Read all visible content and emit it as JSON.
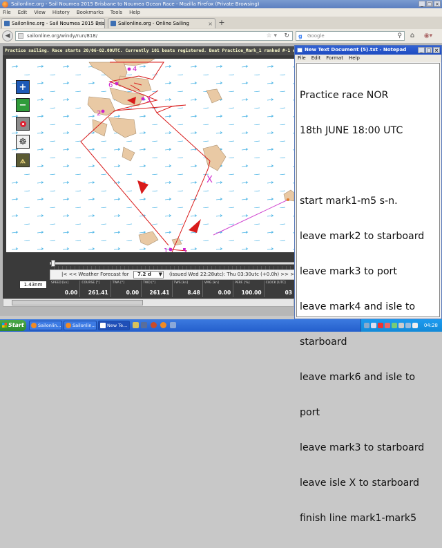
{
  "browser": {
    "window_title": "Sailonline.org - Sail Noumea 2015 Brisbane to Noumea Ocean Race - Mozilla Firefox (Private Browsing)",
    "menu": [
      "File",
      "Edit",
      "View",
      "History",
      "Bookmarks",
      "Tools",
      "Help"
    ],
    "tabs": [
      {
        "label": "Sailonline.org - Sail Noumea 2015 Brisban..."
      },
      {
        "label": "Sailonline.org - Online Sailing"
      }
    ],
    "new_tab": "+",
    "url": "sailonline.org/windy/run/818/",
    "search_placeholder": "Google"
  },
  "race": {
    "status_text": "Practice sailing. Race starts 20/06-02.00UTC. Currently 101 boats registered. Boat Practice_Mark_1 ranked #-1 with",
    "map_labels": {
      "mark4": "4",
      "mark6": "6",
      "mark3": "3",
      "mark2": "2",
      "mark1": "1",
      "mark5": "5",
      "isle_x": "X"
    },
    "scale_label": "1.43nm",
    "forecast": {
      "nav_prev": "|< << Weather Forecast for",
      "selected": "7.2 d",
      "issued": "(issued Wed 22:28utc): Thu 03:30utc (+0.0h) >> >|"
    },
    "stats": [
      {
        "label": "SPEED [kn]",
        "value": "0.00"
      },
      {
        "label": "COURSE [°]",
        "value": "261.41"
      },
      {
        "label": "TWA [°]",
        "value": "0.00"
      },
      {
        "label": "TWD [°]",
        "value": "261.41"
      },
      {
        "label": "TWS [kn]",
        "value": "8.48"
      },
      {
        "label": "VMG [kn]",
        "value": "0.00"
      },
      {
        "label": "PERF. [%]",
        "value": "100.00"
      },
      {
        "label": "CLOCK [UTC]",
        "value": "03"
      }
    ]
  },
  "notepad": {
    "title": "New Text Document (5).txt - Notepad",
    "menu": [
      "File",
      "Edit",
      "Format",
      "Help"
    ],
    "lines": [
      "Practice race NOR",
      "18th JUNE 18:00 UTC",
      "",
      "start mark1-m5 s-n.",
      "leave mark2 to starboard",
      "leave mark3 to port",
      "leave mark4 and isle to",
      "starboard",
      "leave mark6 and isle to",
      "port",
      "leave mark3 to starboard",
      "leave isle X to starboard",
      "finish line mark1-mark5"
    ]
  },
  "taskbar": {
    "start_label": "Start",
    "buttons": [
      "Sailonlin...",
      "Sailonlin...",
      "New Te..."
    ],
    "clock": "04:28"
  },
  "colors": {
    "route": "#d81b1b",
    "land": "#e9c9a4",
    "mark": "#cc22cc",
    "wind_arrow": "#4fb6e6"
  }
}
